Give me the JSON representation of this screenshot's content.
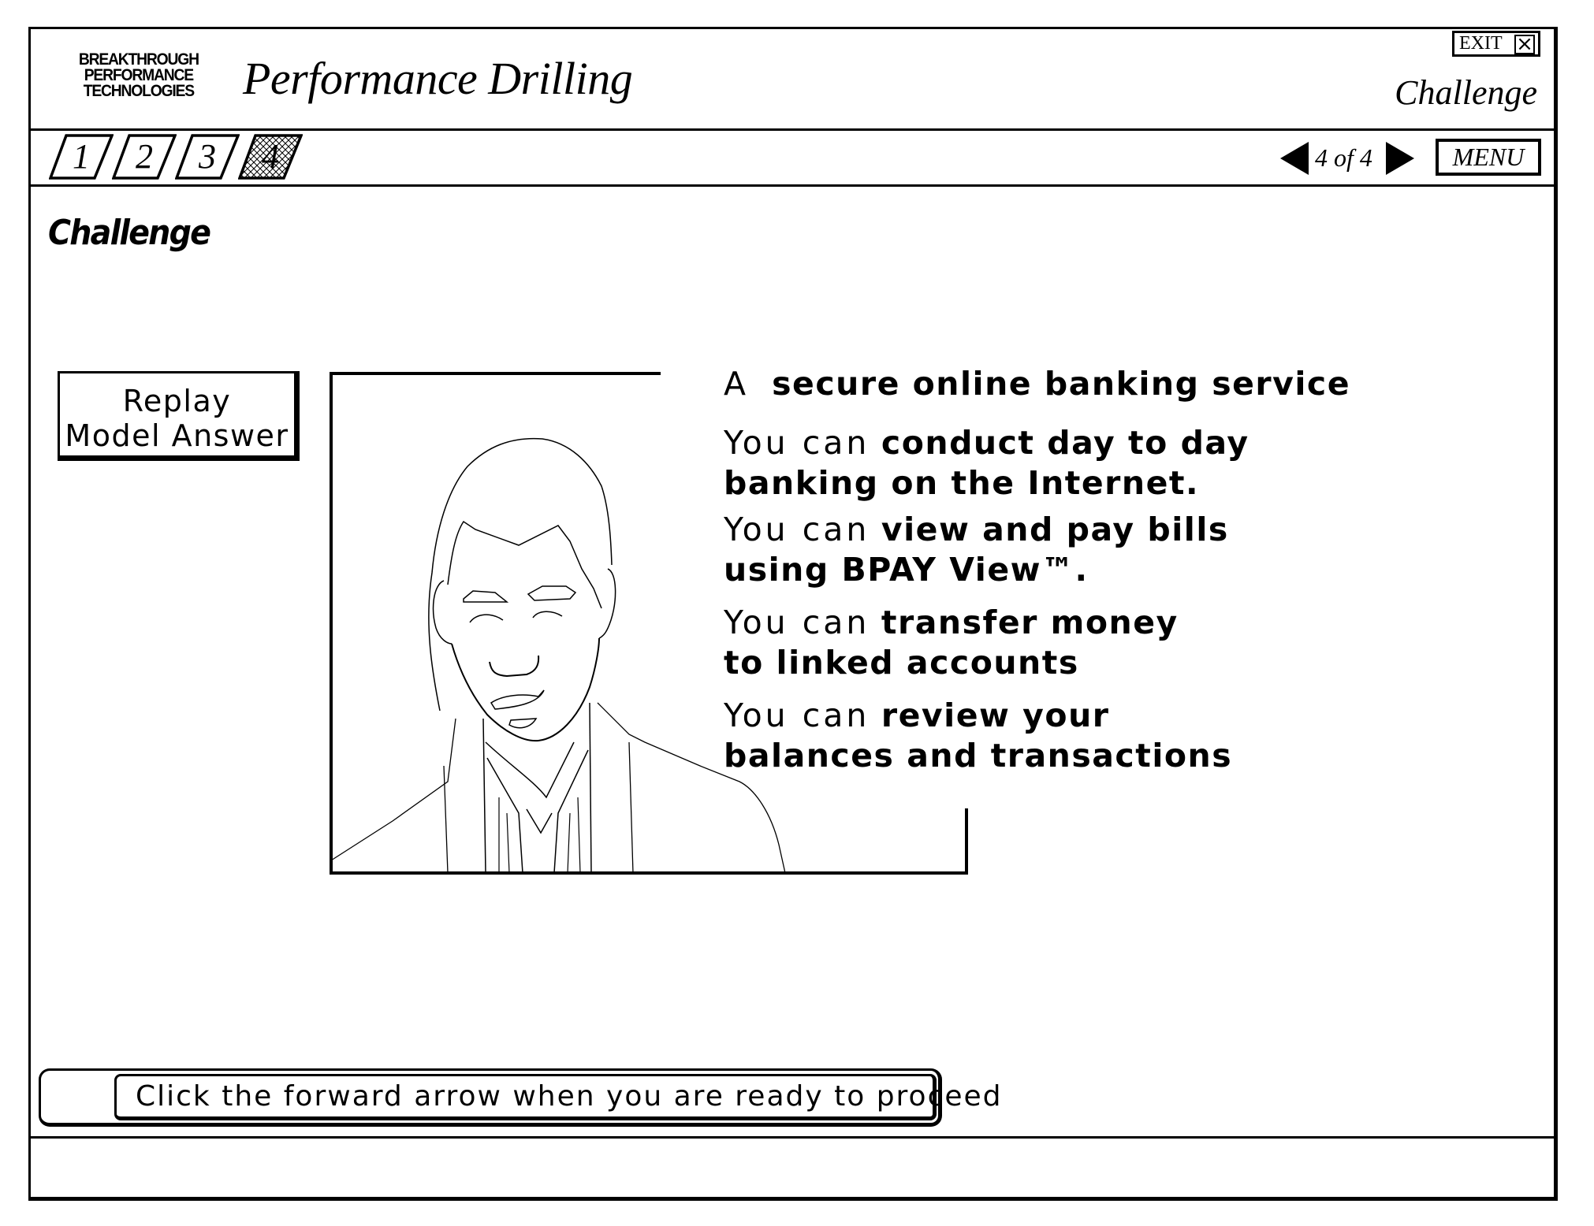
{
  "header": {
    "logo_lines": [
      "BREAKTHROUGH",
      "PERFORMANCE",
      "TECHNOLOGIES"
    ],
    "app_title": "Performance Drilling",
    "exit_label": "EXIT",
    "exit_icon": "close-x-icon",
    "section_title": "Challenge"
  },
  "tabbar": {
    "tabs": [
      {
        "label": "1",
        "active": false
      },
      {
        "label": "2",
        "active": false
      },
      {
        "label": "3",
        "active": false
      },
      {
        "label": "4",
        "active": true
      }
    ],
    "prev_icon": "triangle-left-icon",
    "next_icon": "triangle-right-icon",
    "page_indicator": "4 of 4",
    "menu_label": "MENU"
  },
  "main": {
    "heading": "Challenge",
    "replay_button": {
      "line1": "Replay",
      "line2": "Model Answer"
    },
    "illustration": "man-in-suit-line-drawing",
    "content": {
      "intro": {
        "prefix": "A",
        "bold": "secure online banking service"
      },
      "items": [
        {
          "prefix": "You can",
          "bold1": "conduct day to day",
          "bold2": "banking on the Internet."
        },
        {
          "prefix": "You can",
          "bold1": "view and pay bills",
          "bold2": "using BPAY View™."
        },
        {
          "prefix": "You can",
          "bold1": "transfer money",
          "bold2": "to linked accounts"
        },
        {
          "prefix": "You can",
          "bold1": "review your",
          "bold2": "balances and transactions"
        }
      ]
    }
  },
  "footer": {
    "instruction": "Click the forward arrow when you are ready to proceed"
  }
}
